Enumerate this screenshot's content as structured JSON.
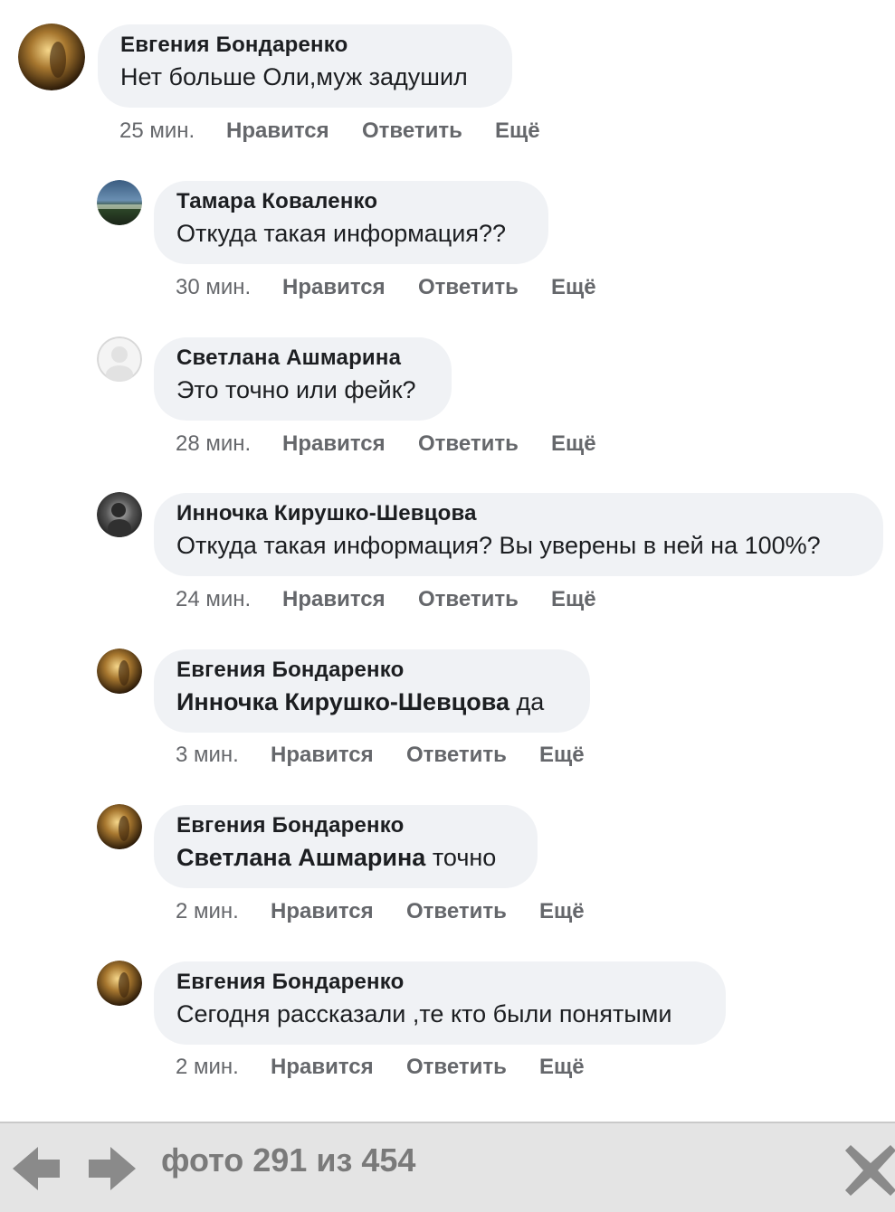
{
  "comments": [
    {
      "author": "Евгения Бондаренко",
      "mention": "",
      "text": "Нет больше Оли,муж задушил",
      "time": "25 мин.",
      "like": "Нравится",
      "reply": "Ответить",
      "more": "Ещё"
    },
    {
      "author": "Тамара Коваленко",
      "mention": "",
      "text": "Откуда такая информация??",
      "time": "30 мин.",
      "like": "Нравится",
      "reply": "Ответить",
      "more": "Ещё"
    },
    {
      "author": "Светлана Ашмарина",
      "mention": "",
      "text": "Это точно или фейк?",
      "time": "28 мин.",
      "like": "Нравится",
      "reply": "Ответить",
      "more": "Ещё"
    },
    {
      "author": "Инночка Кирушко-Шевцова",
      "mention": "",
      "text": "Откуда такая информация? Вы уверены в ней на 100%?",
      "time": "24 мин.",
      "like": "Нравится",
      "reply": "Ответить",
      "more": "Ещё"
    },
    {
      "author": "Евгения Бондаренко",
      "mention": "Инночка Кирушко-Шевцова",
      "text": " да",
      "time": "3 мин.",
      "like": "Нравится",
      "reply": "Ответить",
      "more": "Ещё"
    },
    {
      "author": "Евгения Бондаренко",
      "mention": "Светлана Ашмарина",
      "text": " точно",
      "time": "2 мин.",
      "like": "Нравится",
      "reply": "Ответить",
      "more": "Ещё"
    },
    {
      "author": "Евгения Бондаренко",
      "mention": "",
      "text": "Сегодня рассказали ,те кто были понятыми",
      "time": "2 мин.",
      "like": "Нравится",
      "reply": "Ответить",
      "more": "Ещё"
    }
  ],
  "viewer": {
    "counter": "фото 291 из 454",
    "prev_icon": "left-arrow-icon",
    "next_icon": "right-arrow-icon",
    "close_icon": "close-icon"
  },
  "colors": {
    "bubble": "#f0f2f5",
    "meta": "#65676b",
    "bar": "#e4e4e4",
    "bar_icon": "#8a8a8a"
  }
}
